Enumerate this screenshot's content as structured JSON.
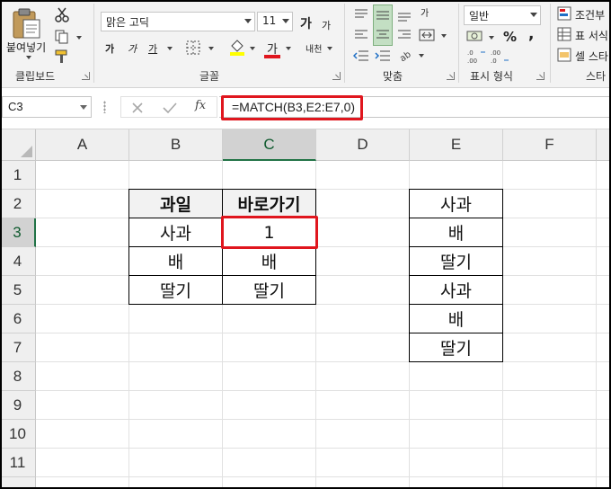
{
  "ribbon": {
    "clipboard": {
      "paste_label": "붙여넣기",
      "group_label": "클립보드"
    },
    "font": {
      "font_name": "맑은 고딕",
      "font_size": "11",
      "grow_label": "가",
      "shrink_label": "가",
      "bold_label": "가",
      "italic_label": "가",
      "underline_label": "가",
      "font_color_label": "가",
      "phonetic_label": "내천",
      "group_label": "글꼴"
    },
    "alignment": {
      "wrap_label": "가",
      "group_label": "맞춤"
    },
    "number": {
      "format_value": "일반",
      "percent_label": "%",
      "comma_label": ",",
      "group_label": "표시 형식"
    },
    "styles": {
      "conditional_label": "조건부",
      "table_label": "표 서식",
      "cell_style_label": "셀 스타",
      "group_label": "스타"
    }
  },
  "formula_bar": {
    "name_box": "C3",
    "fx_label": "fx",
    "formula": "=MATCH(B3,E2:E7,0)"
  },
  "columns": [
    "A",
    "B",
    "C",
    "D",
    "E",
    "F"
  ],
  "rows": [
    "1",
    "2",
    "3",
    "4",
    "5",
    "6",
    "7",
    "8",
    "9",
    "10",
    "11"
  ],
  "table1": {
    "header_fruit": "과일",
    "header_shortcut": "바로가기",
    "fruits": [
      "사과",
      "배",
      "딸기"
    ],
    "shortcuts": [
      "1",
      "배",
      "딸기"
    ]
  },
  "list_e": [
    "사과",
    "배",
    "딸기",
    "사과",
    "배",
    "딸기"
  ],
  "colors": {
    "highlight_red": "#e0161e",
    "excel_green": "#217346",
    "selected_header": "#d2d2d2"
  }
}
